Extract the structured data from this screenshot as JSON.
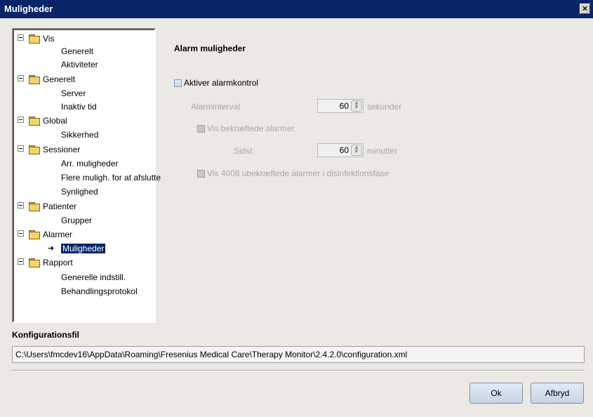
{
  "window": {
    "title": "Muligheder",
    "close_glyph": "×"
  },
  "tree": {
    "groups": [
      {
        "label": "Vis",
        "children": [
          "Generelt",
          "Aktiviteter"
        ]
      },
      {
        "label": "Generelt",
        "children": [
          "Server",
          "Inaktiv tid"
        ]
      },
      {
        "label": "Global",
        "children": [
          "Sikkerhed"
        ]
      },
      {
        "label": "Sessioner",
        "children": [
          "Arr. muligheder",
          "Flere muligh. for at afslutte",
          "Synlighed"
        ]
      },
      {
        "label": "Patienter",
        "children": [
          "Grupper"
        ]
      },
      {
        "label": "Alarmer",
        "children": [
          "Muligheder"
        ]
      },
      {
        "label": "Rapport",
        "children": [
          "Generelle indstill.",
          "Behandlingsprotokol"
        ]
      }
    ],
    "selected": "Alarmer/Muligheder",
    "icons": {
      "expander": "minus-box-icon",
      "folder": "folder-icon",
      "selected_marker": "arrow-right-icon"
    }
  },
  "panel": {
    "heading": "Alarm muligheder",
    "enable_alarm_check": {
      "label": "Aktiver alarmkontrol",
      "checked": false
    },
    "interval": {
      "label": "Alarminterval",
      "value": "60",
      "unit": "sekunder"
    },
    "show_confirmed": {
      "label": "Vis bekræftede alarmer"
    },
    "last": {
      "label": "Sidst",
      "value": "60",
      "unit": "minutter"
    },
    "show_unconfirmed": {
      "label": "Vis 4008 ubekræftede alarmer i disinfektionsfase"
    }
  },
  "config": {
    "title": "Konfigurationsfil",
    "path": "C:\\Users\\fmcdev16\\AppData\\Roaming\\Fresenius Medical Care\\Therapy Monitor\\2.4.2.0\\configuration.xml"
  },
  "buttons": {
    "ok": "Ok",
    "cancel": "Afbryd"
  },
  "colors": {
    "titlebar": "#0a246a",
    "background": "#ece9e4",
    "selection": "#0a246a"
  }
}
